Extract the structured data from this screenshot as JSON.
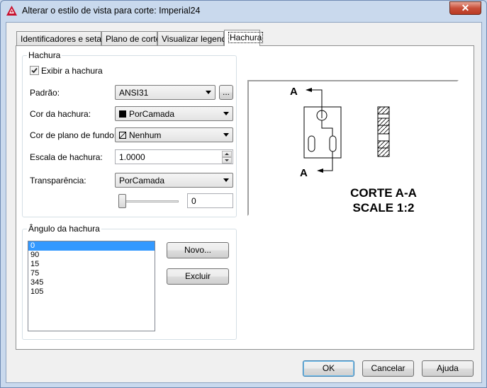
{
  "window": {
    "title": "Alterar o estilo de vista para corte: Imperial24",
    "close_glyph": "✕"
  },
  "tabs": [
    {
      "label": "Identificadores e setas"
    },
    {
      "label": "Plano de corte"
    },
    {
      "label": "Visualizar legenda"
    },
    {
      "label": "Hachura"
    }
  ],
  "hatch_group": {
    "legend": "Hachura",
    "show_hatch_label": "Exibir a hachura",
    "show_hatch_checked": true,
    "pattern_label": "Padrão:",
    "pattern_value": "ANSI31",
    "browse_label": "...",
    "hatch_color_label": "Cor da hachura:",
    "hatch_color_value": "PorCamada",
    "hatch_color_swatch": "#000000",
    "bg_color_label": "Cor de plano de fundo:",
    "bg_color_value": "Nenhum",
    "scale_label": "Escala de hachura:",
    "scale_value": "1.0000",
    "transparency_label": "Transparência:",
    "transparency_value": "PorCamada",
    "transparency_slider_value": "0"
  },
  "angle_group": {
    "legend": "Ângulo da hachura",
    "angles": [
      "0",
      "90",
      "15",
      "75",
      "345",
      "105"
    ],
    "selected_index": 0,
    "new_label": "Novo...",
    "delete_label": "Excluir"
  },
  "preview": {
    "label_top": "A",
    "label_bottom": "A",
    "caption_line1": "CORTE A-A",
    "caption_line2": "SCALE 1:2"
  },
  "footer": {
    "ok_label": "OK",
    "cancel_label": "Cancelar",
    "help_label": "Ajuda"
  },
  "colors": {
    "selection": "#3399ff",
    "app_icon": "#c8102e"
  }
}
